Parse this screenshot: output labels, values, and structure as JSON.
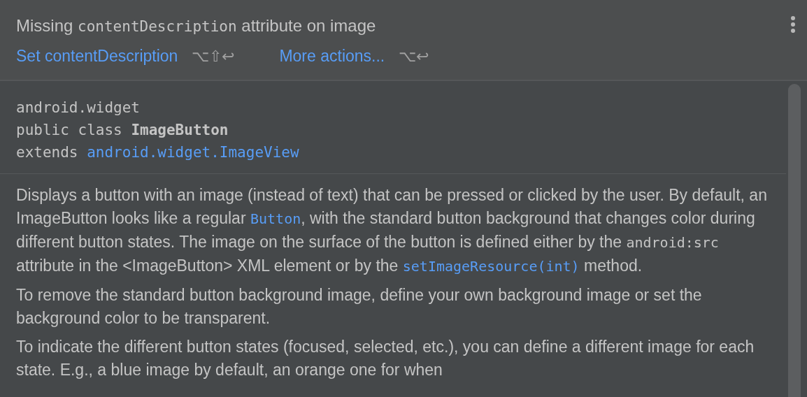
{
  "inspection": {
    "message": [
      {
        "kind": "text",
        "text": "Missing "
      },
      {
        "kind": "code",
        "text": "contentDescription"
      },
      {
        "kind": "text",
        "text": " attribute on image"
      }
    ],
    "actions": [
      {
        "label": "Set contentDescription",
        "shortcut": "⌥⇧↩"
      },
      {
        "label": "More actions...",
        "shortcut": "⌥↩"
      }
    ]
  },
  "signature": {
    "package": "android.widget",
    "declaration": "public class",
    "class_name": "ImageButton",
    "extends_keyword": "extends",
    "superclass": "android.widget.ImageView"
  },
  "paragraphs": [
    [
      {
        "kind": "text",
        "text": "Displays a button with an image (instead of text) that can be pressed or clicked by the user. By default, an ImageButton looks like a regular "
      },
      {
        "kind": "link",
        "text": "Button"
      },
      {
        "kind": "text",
        "text": ", with the standard button background that changes color during different button states. The image on the surface of the button is defined either by the "
      },
      {
        "kind": "code",
        "text": "android:src"
      },
      {
        "kind": "text",
        "text": " attribute in the <ImageButton> XML element or by the "
      },
      {
        "kind": "link",
        "text": "setImageResource(int)"
      },
      {
        "kind": "text",
        "text": " method."
      }
    ],
    [
      {
        "kind": "text",
        "text": "To remove the standard button background image, define your own background image or set the background color to be transparent."
      }
    ],
    [
      {
        "kind": "text",
        "text": "To indicate the different button states (focused, selected, etc.), you can define a different image for each state. E.g., a blue image by default, an orange one for when"
      }
    ]
  ]
}
